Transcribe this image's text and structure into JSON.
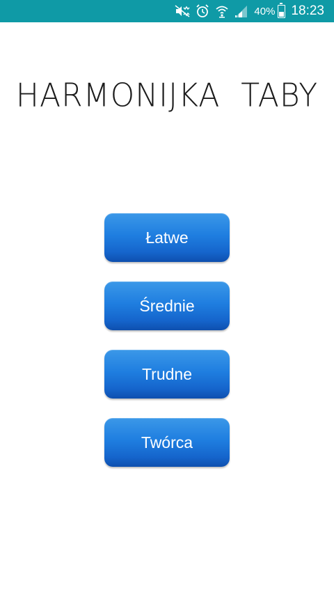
{
  "status_bar": {
    "battery_percent": "40%",
    "battery_level": 0.4,
    "time": "18:23",
    "icons": [
      "mute-icon",
      "alarm-icon",
      "wifi-icon",
      "signal-icon",
      "battery-icon"
    ],
    "background_color": "#0f9aa6"
  },
  "app": {
    "title": "HARMONIJKA  TABY"
  },
  "menu": {
    "buttons": [
      {
        "label": "Łatwe"
      },
      {
        "label": "Średnie"
      },
      {
        "label": "Trudne"
      },
      {
        "label": "Twórca"
      }
    ],
    "button_color": "#1f7ee0"
  }
}
